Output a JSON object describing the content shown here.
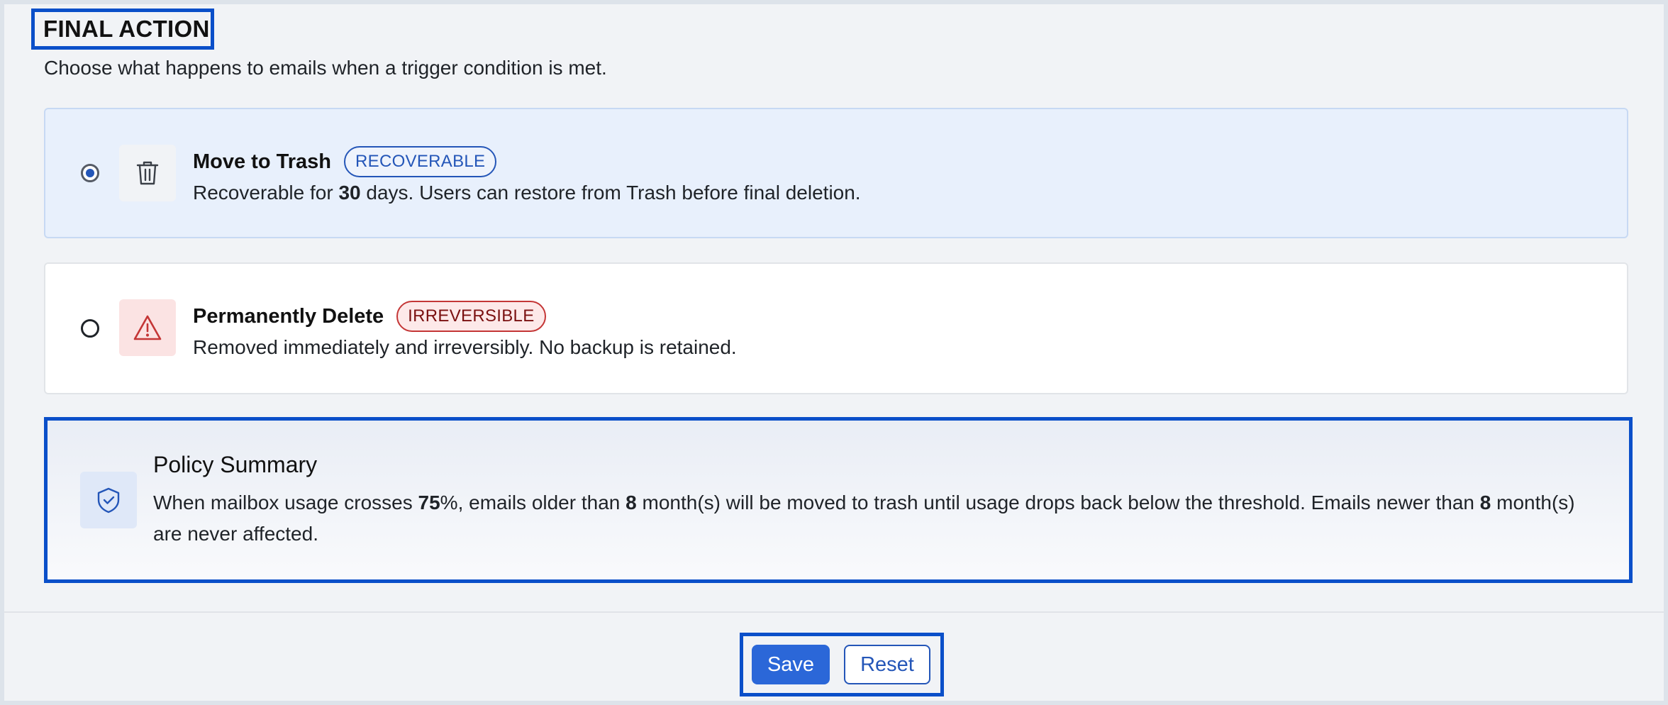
{
  "section": {
    "title": "FINAL ACTION",
    "subtitle": "Choose what happens to emails when a trigger condition is met."
  },
  "options": [
    {
      "name": "Move to Trash",
      "badge": "RECOVERABLE",
      "desc_prefix": "Recoverable for ",
      "desc_days": "30",
      "desc_suffix": " days. Users can restore from Trash before final deletion.",
      "selected": true,
      "icon": "trash-icon"
    },
    {
      "name": "Permanently Delete",
      "badge": "IRREVERSIBLE",
      "desc": "Removed immediately and irreversibly. No backup is retained.",
      "selected": false,
      "icon": "warning-icon"
    }
  ],
  "summary": {
    "title": "Policy Summary",
    "text_1": "When mailbox usage crosses ",
    "threshold": "75",
    "text_2": "%, emails older than ",
    "age": "8",
    "text_3": " month(s) will be moved to trash until usage drops back below the threshold. Emails newer than ",
    "age_again": "8",
    "text_4": " month(s) are never affected.",
    "icon": "shield-check-icon"
  },
  "actions": {
    "save_label": "Save",
    "reset_label": "Reset"
  },
  "colors": {
    "accent": "#2b67d8",
    "highlight_border": "#0a4fc9",
    "danger": "#c43636",
    "selected_bg": "#e8f0fc"
  }
}
